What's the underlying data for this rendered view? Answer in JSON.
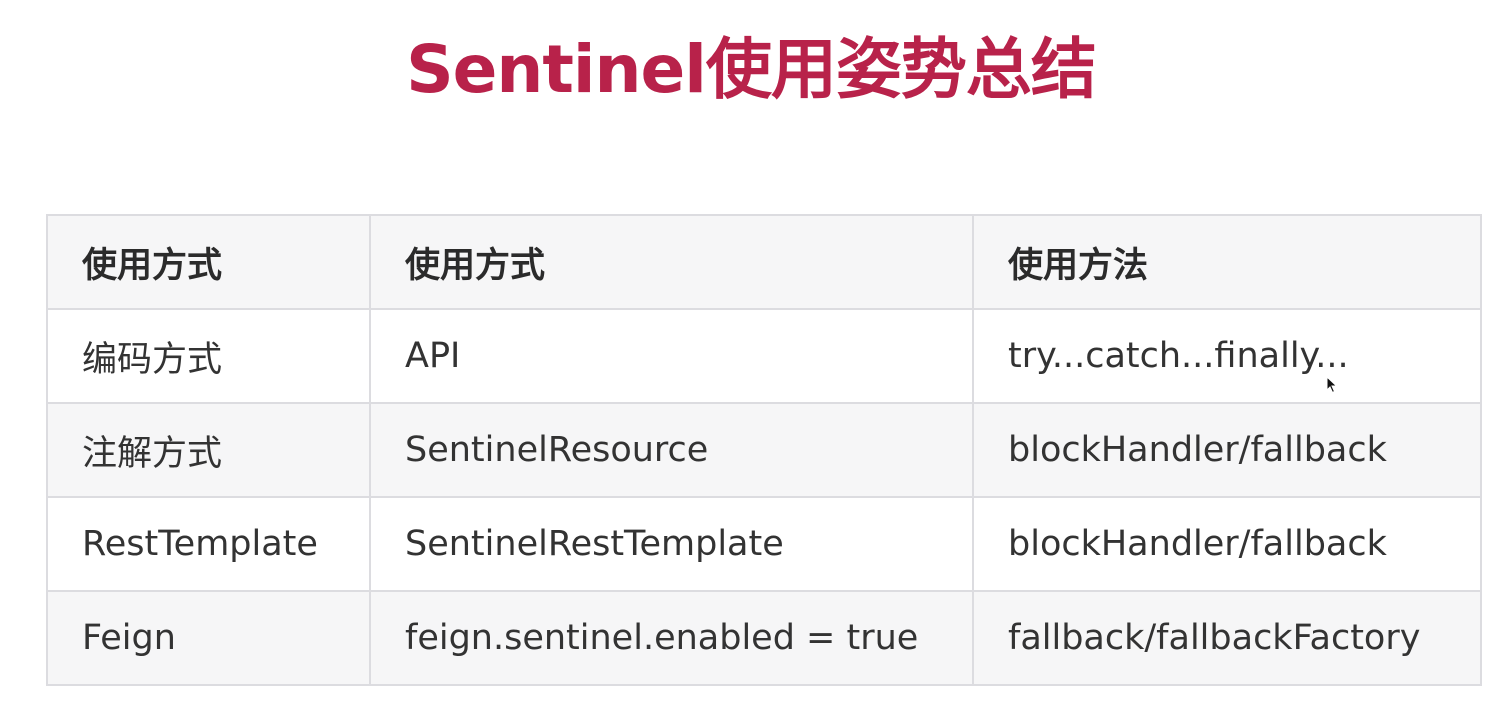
{
  "title": "Sentinel使用姿势总结",
  "table": {
    "headers": [
      "使用方式",
      "使用方式",
      "使用方法"
    ],
    "rows": [
      [
        "编码方式",
        "API",
        "try...catch...finally..."
      ],
      [
        "注解方式",
        "SentinelResource",
        "blockHandler/fallback"
      ],
      [
        "RestTemplate",
        "SentinelRestTemplate",
        "blockHandler/fallback"
      ],
      [
        "Feign",
        "feign.sentinel.enabled = true",
        "fallback/fallbackFactory"
      ]
    ]
  },
  "colors": {
    "title": "#b8224a",
    "border": "#dcdce0",
    "header_bg": "#f6f6f7",
    "text": "#333333"
  },
  "icons": [
    "mouse-cursor-icon"
  ]
}
